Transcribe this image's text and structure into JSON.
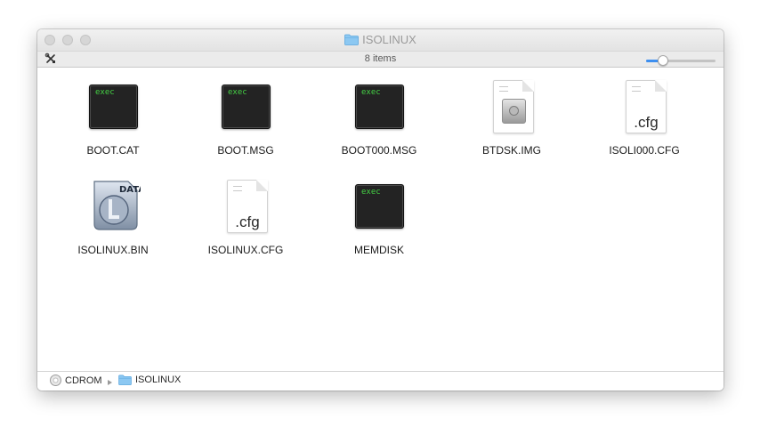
{
  "window": {
    "title": "ISOLINUX",
    "item_count": "8 items",
    "icon_size_level": 0.2
  },
  "toolbar": {
    "action_icon": "tools-icon"
  },
  "files": [
    {
      "name": "BOOT.CAT",
      "kind": "exec",
      "badge": "exec"
    },
    {
      "name": "BOOT.MSG",
      "kind": "exec",
      "badge": "exec"
    },
    {
      "name": "BOOT000.MSG",
      "kind": "exec",
      "badge": "exec"
    },
    {
      "name": "BTDSK.IMG",
      "kind": "disk-image"
    },
    {
      "name": "ISOLI000.CFG",
      "kind": "document",
      "ext": ".cfg"
    },
    {
      "name": "ISOLINUX.BIN",
      "kind": "data",
      "badge": "DATA"
    },
    {
      "name": "ISOLINUX.CFG",
      "kind": "document",
      "ext": ".cfg"
    },
    {
      "name": "MEMDISK",
      "kind": "exec",
      "badge": "exec"
    }
  ],
  "path_bar": {
    "items": [
      {
        "label": "CDROM",
        "icon": "cd-icon"
      },
      {
        "label": "ISOLINUX",
        "icon": "folder-icon"
      }
    ]
  },
  "colors": {
    "folder": "#6fb8ee",
    "exec_text": "#44d044",
    "accent": "#3d8ff0"
  }
}
